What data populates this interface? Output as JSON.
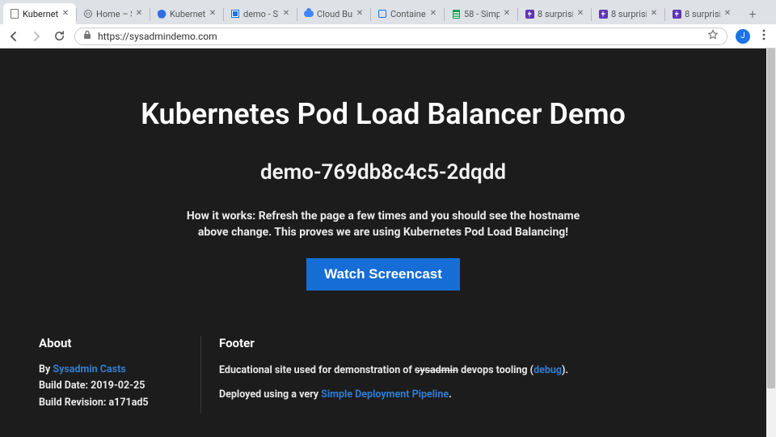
{
  "browser": {
    "tabs": [
      {
        "title": "Kubernete"
      },
      {
        "title": "Home – S"
      },
      {
        "title": "Kubernete"
      },
      {
        "title": "demo - S"
      },
      {
        "title": "Cloud Bu"
      },
      {
        "title": "Containe"
      },
      {
        "title": "58 - Simp"
      },
      {
        "title": "8 surprisi"
      },
      {
        "title": "8 surprisi"
      },
      {
        "title": "8 surprisi"
      }
    ],
    "url": "https://sysadmindemo.com",
    "avatar_initial": "J"
  },
  "hero": {
    "title": "Kubernetes Pod Load Balancer Demo",
    "hostname": "demo-769db8c4c5-2dqdd",
    "how_prefix": "How it works: ",
    "how_text": "Refresh the page a few times and you should see the hostname above change. This proves we are using Kubernetes Pod Load Balancing!",
    "cta_label": "Watch Screencast"
  },
  "footer": {
    "about": {
      "heading": "About",
      "by_label": "By ",
      "by_link": "Sysadmin Casts",
      "build_date_label": "Build Date: ",
      "build_date": "2019-02-25",
      "build_rev_label": "Build Revision: ",
      "build_rev": "a171ad5"
    },
    "footer": {
      "heading": "Footer",
      "line1_a": "Educational site used for demonstration of ",
      "line1_strike": "sysadmin",
      "line1_b": " devops tooling (",
      "line1_link": "debug",
      "line1_c": ").",
      "line2_a": "Deployed using a very ",
      "line2_link": "Simple Deployment Pipeline",
      "line2_b": "."
    }
  }
}
